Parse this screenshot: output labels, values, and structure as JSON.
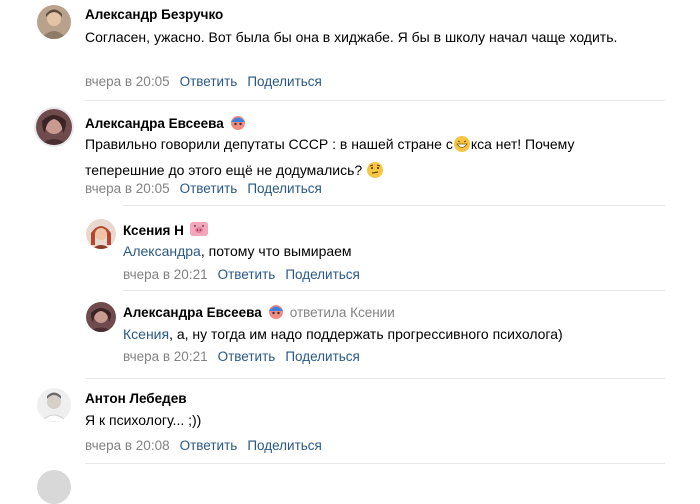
{
  "comments": [
    {
      "author": "Александр Безручко",
      "text": "Согласен, ужасно. Вот была бы она в хиджабе. Я бы в школу начал чаще ходить.",
      "time": "вчера в 20:05",
      "reply": "Ответить",
      "share": "Поделиться"
    },
    {
      "author": "Александра Евсеева",
      "text_a": "Правильно говорили депутаты СССР : в нашей стране с",
      "text_b": "кса нет! Почему",
      "text_c": "теперешние до этого ещё не додумались?",
      "time": "вчера в 20:05",
      "reply": "Ответить",
      "share": "Поделиться"
    },
    {
      "author": "Ксения Н",
      "mention": "Александра",
      "text": ", потому что вымираем",
      "time": "вчера в 20:21",
      "reply": "Ответить",
      "share": "Поделиться"
    },
    {
      "author": "Александра Евсеева",
      "replied_to": "ответила Ксении",
      "mention": "Ксения",
      "text": ", а, ну тогда им надо поддержать прогрессивного психолога)",
      "time": "вчера в 20:21",
      "reply": "Ответить",
      "share": "Поделиться"
    },
    {
      "author": "Антон Лебедев",
      "text": "Я к психологу... ;))",
      "time": "вчера в 20:08",
      "reply": "Ответить",
      "share": "Поделиться"
    }
  ],
  "colors": {
    "link": "#2a5885",
    "meta": "#828282",
    "divider": "#e7e8ec"
  }
}
